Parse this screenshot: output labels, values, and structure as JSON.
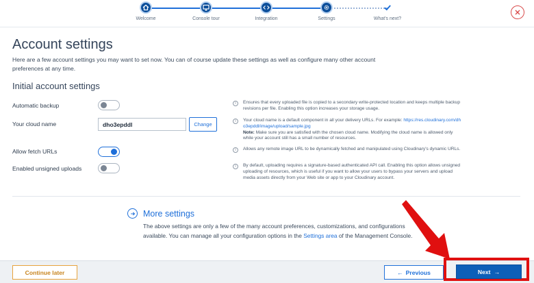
{
  "stepper": {
    "steps": [
      {
        "label": "Welcome",
        "icon": "home-icon"
      },
      {
        "label": "Console tour",
        "icon": "monitor-icon"
      },
      {
        "label": "Integration",
        "icon": "code-icon"
      },
      {
        "label": "Settings",
        "icon": "gear-icon"
      },
      {
        "label": "What's next?",
        "icon": "check-icon"
      }
    ]
  },
  "header": {
    "title": "Account settings",
    "intro": "Here are a few account settings you may want to set now. You can of course update these settings as well as configure many other account preferences at any time."
  },
  "initial": {
    "title": "Initial account settings",
    "automatic_backup": {
      "label": "Automatic backup",
      "state": "off",
      "info": "Ensures that every uploaded file is copied to a secondary write-protected location and keeps multiple backup revisions per file. Enabling this option increases your storage usage."
    },
    "cloud_name": {
      "label": "Your cloud name",
      "value": "dho3epddl",
      "change_label": "Change",
      "info_prefix": "Your cloud name is a default component in all your delivery URLs. For example: ",
      "info_link": "https://res.cloudinary.com/dho3epddl/image/upload/sample.jpg",
      "info_note_label": "Note:",
      "info_note": " Make sure you are satisfied with the chosen cloud name. Modifying the cloud name is allowed only while your account still has a small number of resources."
    },
    "fetch_urls": {
      "label": "Allow fetch URLs",
      "state": "on",
      "info": "Allows any remote image URL to be dynamically fetched and manipulated using Cloudinary's dynamic URLs."
    },
    "unsigned_uploads": {
      "label": "Enabled unsigned uploads",
      "state": "off",
      "info": "By default, uploading requires a signature-based authenticated API call. Enabling this option allows unsigned uploading of resources, which is useful if you want to allow your users to bypass your servers and upload media assets directly from your Web site or app to your Cloudinary account."
    }
  },
  "more": {
    "title": "More settings",
    "text_prefix": "The above settings are only a few of the many account preferences, customizations, and configurations available. You can manage all your configuration options in the ",
    "link": "Settings area",
    "text_suffix": " of the Management Console."
  },
  "footer": {
    "continue_label": "Continue later",
    "previous_label": "Previous",
    "next_label": "Next"
  },
  "colors": {
    "accent": "#1e6fd9",
    "primary_button": "#0d5fb8",
    "warning_button": "#e8a33c",
    "highlight": "#e01010"
  }
}
